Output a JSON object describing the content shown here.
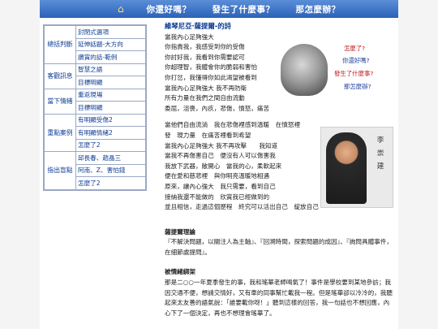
{
  "nav": {
    "items": [
      "你還好嗎？",
      "發生了什麼事？",
      "那怎麼辦？"
    ]
  },
  "sidebar": {
    "groups": [
      {
        "category": "總括判斷",
        "links": [
          "封閉式選項",
          "延伸話題-大方向",
          "讚賞的話-範例"
        ]
      },
      {
        "category": "客觀訊息",
        "links": [
          "智慧之語",
          "目標明顯"
        ]
      },
      {
        "category": "當下情緒",
        "links": [
          "重返現場",
          "目標明顯"
        ]
      },
      {
        "category": "重點案例",
        "links": [
          "有明顯受傷2",
          "有明顯情緒2",
          "怎麼了2"
        ]
      },
      {
        "category": "指出盲點",
        "links": [
          "邱長春、趙晶三",
          "阿南、Z、害怕錢",
          "怎麼了2"
        ]
      }
    ]
  },
  "poem": {
    "title": "維琴尼亞·薩提爾-的詩",
    "lines1": [
      "當我內心足夠強大",
      "你指責我，我感受到你的受傷",
      "你討好我，我看到你需要認可",
      "你超理智，我體會你的脆弱和害怕",
      "你打岔，我懂得你如此渴望被看到",
      "當我內心足夠強大 我不再防衛",
      "所有力量在我們之間自由流動",
      "委屈，沮喪，內疚，悲傷，憤怒，痛苦"
    ],
    "lines2": [
      "當他們自由流淌　我在悲傷裡感到溫暖　在憤怒裡",
      "發　現力量　在痛苦裡看到希望",
      "當我內心足夠強大 我不再攻擊　　我知道",
      "當我不再傷害自己　便沒有人可以傷害我",
      "我放下武器，敞開心　當我的心，柔軟起來",
      "便在愛和慈悲裡　與你明亮溫暖地相遇",
      "原來，讓內心強大　我只需要，看到自己",
      "接納我還不能做的　欣賞我已經做到的",
      "並且相信，走過這個歷程　終究可以活出自己　綻放自己"
    ]
  },
  "photo1": {
    "questions": [
      "怎麼了?",
      "你還好嗎?",
      "發生了什麼事?",
      "那怎麼辦?"
    ],
    "question_colors": [
      "#c0181b",
      "#1c3f9c",
      "#c0181b",
      "#1c3f9c"
    ]
  },
  "photo2": {
    "name": "李崇建"
  },
  "sections": {
    "satir_title": "薩提爾理論",
    "satir_text": "『不解決問題，以關注人為主軸』、『回溯時間，探索問題的成因』、『詢問具體事件，在細節處提問』。",
    "case_title": "被情緒綁架",
    "case_text": "那是二○○一年夏季發生的事，我和瑤華老師喝氣了！事件是學校要到某地參訪；我因交通不便，想請交情好，又有車的同事幫忙載我一程。但是瑤華卻以冷冷的，我聽起來太友善的語氣說：「誰要載你呀！」聽到這樣的回答，我一句話也不想回應，內心下了一個決定，再也不想理會瑤華了。"
  }
}
